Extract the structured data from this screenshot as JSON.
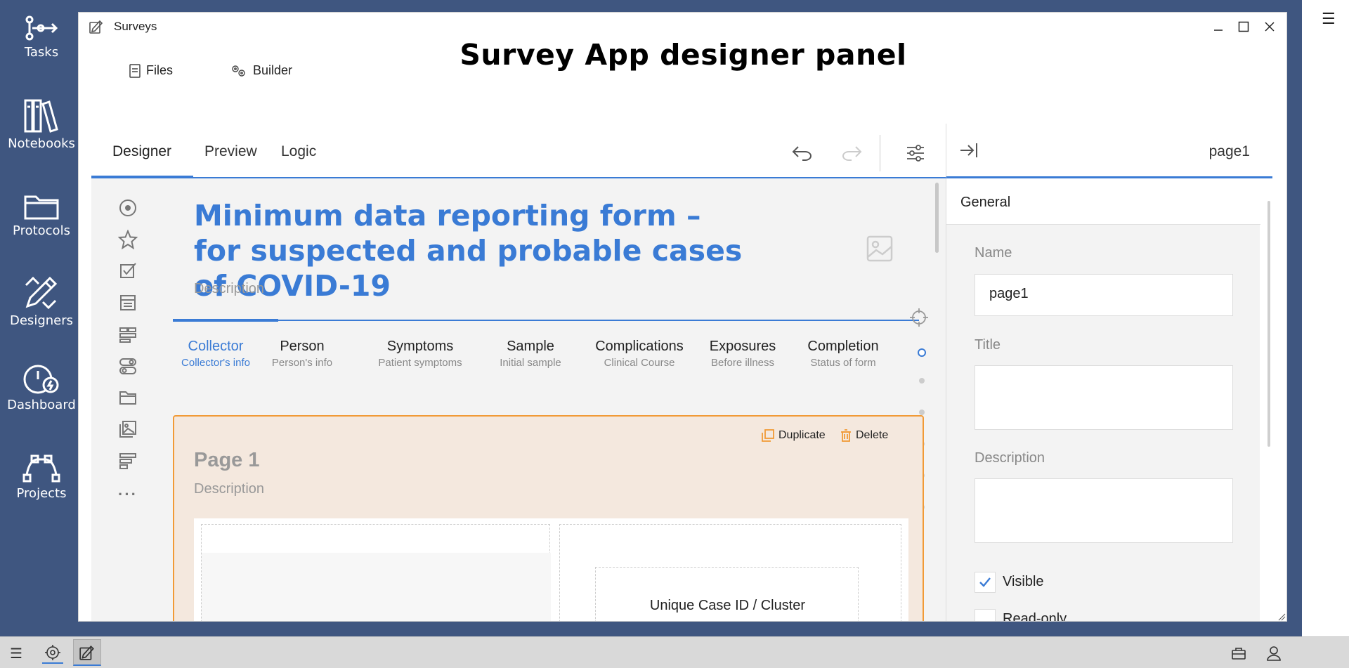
{
  "app_sidebar": {
    "items": [
      {
        "label": "Tasks",
        "icon": "tasks-flow-icon"
      },
      {
        "label": "Notebooks",
        "icon": "books-icon"
      },
      {
        "label": "Protocols",
        "icon": "folder-icon"
      },
      {
        "label": "Designers",
        "icon": "pencil-ruler-icon"
      },
      {
        "label": "Dashboard",
        "icon": "gauge-icon"
      },
      {
        "label": "Projects",
        "icon": "vector-nodes-icon"
      }
    ]
  },
  "window": {
    "title": "Surveys",
    "heading": "Survey App designer panel",
    "menu": {
      "files": "Files",
      "builder": "Builder"
    }
  },
  "designer": {
    "tabs": [
      "Designer",
      "Preview",
      "Logic"
    ],
    "active_tab": "Designer",
    "survey": {
      "title": "Minimum data reporting form – for suspected and probable cases of COVID-19",
      "description": "Description"
    },
    "pages": [
      {
        "title": "Collector",
        "subtitle": "Collector's info"
      },
      {
        "title": "Person",
        "subtitle": "Person's info"
      },
      {
        "title": "Symptoms",
        "subtitle": "Patient symptoms"
      },
      {
        "title": "Sample",
        "subtitle": "Initial sample"
      },
      {
        "title": "Complications",
        "subtitle": "Clinical Course"
      },
      {
        "title": "Exposures",
        "subtitle": "Before illness"
      },
      {
        "title": "Completion",
        "subtitle": "Status of form"
      }
    ],
    "page_card": {
      "duplicate": "Duplicate",
      "delete": "Delete",
      "heading": "Page 1",
      "description": "Description",
      "question_label": "Unique Case ID / Cluster"
    }
  },
  "properties": {
    "page_name": "page1",
    "section": "General",
    "name_label": "Name",
    "name_value": "page1",
    "title_label": "Title",
    "description_label": "Description",
    "visible_label": "Visible",
    "visible_checked": true,
    "readonly_label": "Read-only",
    "readonly_checked": false
  },
  "colors": {
    "accent": "#3a7bd5",
    "sidebar_bg": "#3f5680",
    "selection_border": "#f19a36",
    "page_card_bg": "#f4e8de"
  }
}
